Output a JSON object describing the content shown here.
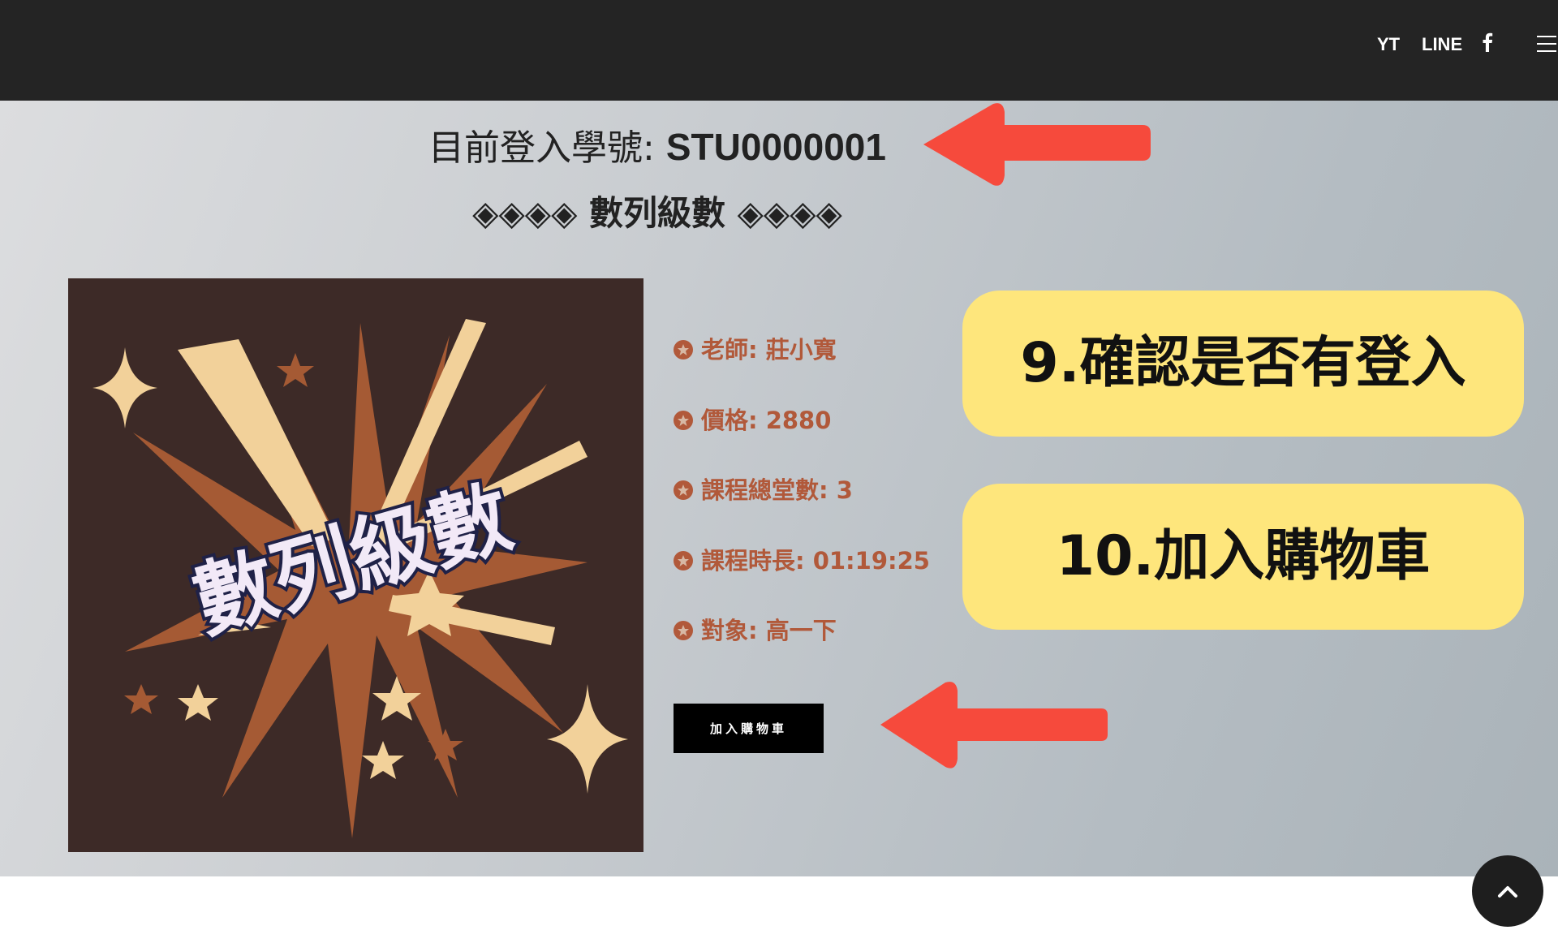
{
  "nav": {
    "yt": "YT",
    "line": "LINE",
    "facebook_icon": "facebook-icon",
    "menu_icon": "hamburger-icon"
  },
  "login": {
    "label": "目前登入學號: ",
    "student_id": "STU0000001"
  },
  "course": {
    "title": "◈◈◈◈ 數列級數 ◈◈◈◈",
    "image_text": "數列級數",
    "info": [
      "老師: 莊小寬",
      "價格: 2880",
      "課程總堂數: 3",
      "課程時長: 01:19:25",
      "對象: 高一下"
    ],
    "add_to_cart": "加入購物車"
  },
  "callouts": {
    "step9": "9.確認是否有登入",
    "step10": "10.加入購物車"
  },
  "colors": {
    "topbar": "#242424",
    "info_text": "#b1593a",
    "callout_bg": "#fee67c",
    "arrow": "#f64a3c",
    "image_bg": "#3d2a27"
  }
}
